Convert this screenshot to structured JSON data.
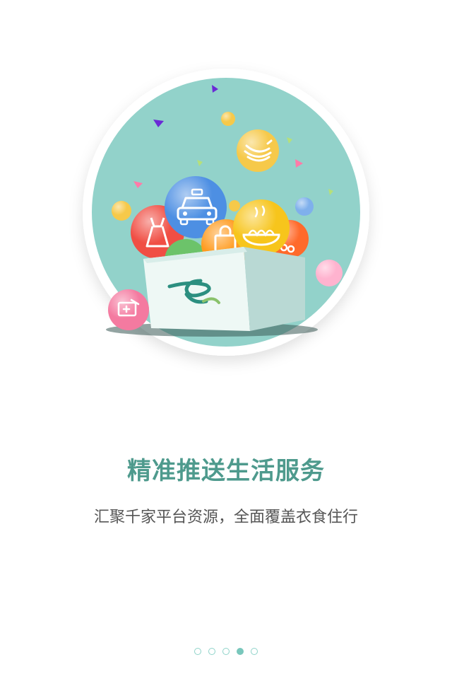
{
  "onboarding": {
    "title": "精准推送生活服务",
    "subtitle": "汇聚千家平台资源，全面覆盖衣食住行",
    "page_count": 5,
    "active_page": 4
  },
  "theme": {
    "accent": "#4e9a8d",
    "circle_bg": "#92d2ca",
    "dot_active": "#79c7bc",
    "dot_border": "#8fd3c9"
  },
  "icons": [
    "taxi-icon",
    "banana-icon",
    "dress-icon",
    "noodle-bowl-icon",
    "shopping-bag-icon",
    "scissors-icon",
    "gift-card-icon",
    "brand-logo-icon"
  ]
}
